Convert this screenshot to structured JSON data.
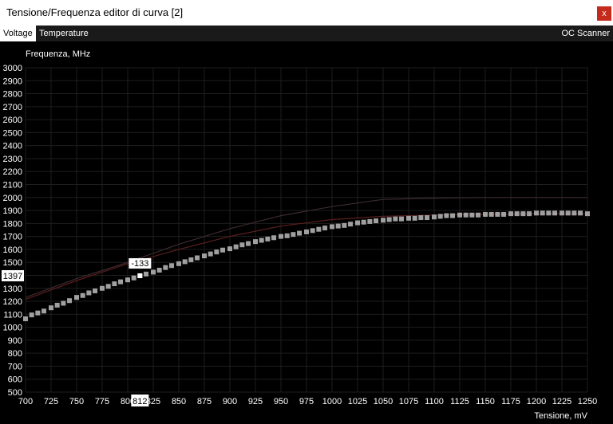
{
  "window": {
    "title": "Tensione/Frequenza editor di curva [2]",
    "close_label": "x"
  },
  "tabs": {
    "voltage": "Voltage",
    "temperature": "Temperature",
    "oc_scanner": "OC Scanner"
  },
  "colors": {
    "curve_points": "#a0a0a0",
    "ref_curve_red": "#5a1e1e",
    "ref_curve_dark": "#3c2a2e",
    "grid": "#1e1e1e"
  },
  "chart_data": {
    "type": "scatter",
    "ylabel": "Frequenza, MHz",
    "xlabel": "Tensione, mV",
    "xlim": [
      700,
      1250
    ],
    "ylim": [
      500,
      3000
    ],
    "x_ticks": [
      700,
      725,
      750,
      775,
      800,
      825,
      850,
      875,
      900,
      925,
      950,
      975,
      1000,
      1025,
      1050,
      1075,
      1100,
      1125,
      1150,
      1175,
      1200,
      1225,
      1250
    ],
    "y_ticks": [
      500,
      600,
      700,
      800,
      900,
      1000,
      1100,
      1200,
      1300,
      1400,
      1500,
      1600,
      1700,
      1800,
      1900,
      2000,
      2100,
      2200,
      2300,
      2400,
      2500,
      2600,
      2700,
      2800,
      2900,
      3000
    ],
    "grid": true,
    "series": [
      {
        "x": [
          700,
          706,
          712,
          718,
          725,
          731,
          737,
          743,
          750,
          756,
          762,
          768,
          775,
          781,
          787,
          793,
          800,
          806,
          812,
          818,
          825,
          831,
          837,
          843,
          850,
          856,
          862,
          868,
          875,
          881,
          887,
          893,
          900,
          906,
          912,
          918,
          925,
          931,
          937,
          943,
          950,
          956,
          962,
          968,
          975,
          981,
          987,
          993,
          1000,
          1006,
          1012,
          1018,
          1025,
          1031,
          1037,
          1043,
          1050,
          1056,
          1062,
          1068,
          1075,
          1081,
          1087,
          1093,
          1100,
          1106,
          1112,
          1118,
          1125,
          1131,
          1137,
          1143,
          1150,
          1156,
          1162,
          1168,
          1175,
          1181,
          1187,
          1193,
          1200,
          1206,
          1212,
          1218,
          1225,
          1231,
          1237,
          1243,
          1250
        ],
        "y": [
          1065,
          1095,
          1110,
          1125,
          1150,
          1170,
          1185,
          1205,
          1230,
          1245,
          1265,
          1280,
          1300,
          1315,
          1335,
          1350,
          1365,
          1380,
          1397,
          1410,
          1425,
          1440,
          1460,
          1475,
          1490,
          1505,
          1520,
          1535,
          1550,
          1565,
          1580,
          1595,
          1605,
          1620,
          1635,
          1645,
          1660,
          1670,
          1680,
          1690,
          1700,
          1705,
          1715,
          1725,
          1735,
          1745,
          1755,
          1765,
          1775,
          1780,
          1785,
          1795,
          1805,
          1810,
          1815,
          1820,
          1825,
          1830,
          1835,
          1835,
          1840,
          1840,
          1845,
          1845,
          1850,
          1855,
          1860,
          1860,
          1865,
          1865,
          1865,
          1865,
          1870,
          1870,
          1870,
          1870,
          1875,
          1875,
          1875,
          1875,
          1880,
          1880,
          1880,
          1880,
          1880,
          1880,
          1880,
          1880,
          1875
        ]
      },
      {
        "x": [
          700,
          750,
          800,
          850,
          900,
          950,
          1000,
          1050,
          1100,
          1150,
          1200,
          1250
        ],
        "y": [
          1215,
          1360,
          1490,
          1600,
          1700,
          1780,
          1830,
          1855,
          1865,
          1870,
          1875,
          1875
        ]
      },
      {
        "x": [
          700,
          750,
          800,
          850,
          900,
          950,
          1000,
          1050,
          1100,
          1150,
          1200,
          1250
        ],
        "y": [
          1230,
          1375,
          1500,
          1640,
          1760,
          1860,
          1930,
          1985,
          1995,
          2000,
          2000,
          2000
        ]
      }
    ],
    "selected": {
      "x": 812,
      "y": 1397,
      "offset": "-133"
    }
  }
}
